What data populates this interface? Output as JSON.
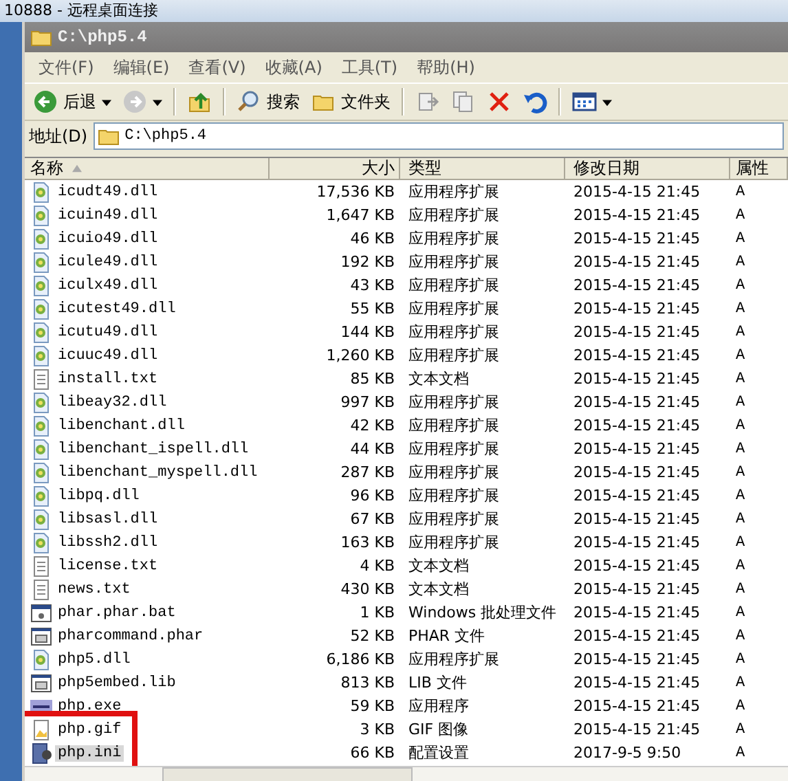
{
  "remote_title": "10888 - 远程桌面连接",
  "window": {
    "title": "C:\\php5.4"
  },
  "menu": [
    "文件(F)",
    "编辑(E)",
    "查看(V)",
    "收藏(A)",
    "工具(T)",
    "帮助(H)"
  ],
  "toolbar": [
    {
      "kind": "back",
      "label": "后退"
    },
    {
      "kind": "forward"
    },
    {
      "kind": "up"
    },
    {
      "kind": "search",
      "label": "搜索"
    },
    {
      "kind": "folders",
      "label": "文件夹"
    },
    {
      "kind": "move"
    },
    {
      "kind": "copy"
    },
    {
      "kind": "delete"
    },
    {
      "kind": "undo"
    },
    {
      "kind": "views"
    }
  ],
  "address": {
    "label": "地址(D)",
    "value": "C:\\php5.4"
  },
  "columns": [
    "名称",
    "大小",
    "类型",
    "修改日期",
    "属性"
  ],
  "rows": [
    {
      "kind": "dll",
      "name": "icudt49.dll",
      "size": "17,536 KB",
      "type": "应用程序扩展",
      "date": "2015-4-15 21:45",
      "attr": "A",
      "selected": false
    },
    {
      "kind": "dll",
      "name": "icuin49.dll",
      "size": "1,647 KB",
      "type": "应用程序扩展",
      "date": "2015-4-15 21:45",
      "attr": "A",
      "selected": false
    },
    {
      "kind": "dll",
      "name": "icuio49.dll",
      "size": "46 KB",
      "type": "应用程序扩展",
      "date": "2015-4-15 21:45",
      "attr": "A",
      "selected": false
    },
    {
      "kind": "dll",
      "name": "icule49.dll",
      "size": "192 KB",
      "type": "应用程序扩展",
      "date": "2015-4-15 21:45",
      "attr": "A",
      "selected": false
    },
    {
      "kind": "dll",
      "name": "iculx49.dll",
      "size": "43 KB",
      "type": "应用程序扩展",
      "date": "2015-4-15 21:45",
      "attr": "A",
      "selected": false
    },
    {
      "kind": "dll",
      "name": "icutest49.dll",
      "size": "55 KB",
      "type": "应用程序扩展",
      "date": "2015-4-15 21:45",
      "attr": "A",
      "selected": false
    },
    {
      "kind": "dll",
      "name": "icutu49.dll",
      "size": "144 KB",
      "type": "应用程序扩展",
      "date": "2015-4-15 21:45",
      "attr": "A",
      "selected": false
    },
    {
      "kind": "dll",
      "name": "icuuc49.dll",
      "size": "1,260 KB",
      "type": "应用程序扩展",
      "date": "2015-4-15 21:45",
      "attr": "A",
      "selected": false
    },
    {
      "kind": "txt",
      "name": "install.txt",
      "size": "85 KB",
      "type": "文本文档",
      "date": "2015-4-15 21:45",
      "attr": "A",
      "selected": false
    },
    {
      "kind": "dll",
      "name": "libeay32.dll",
      "size": "997 KB",
      "type": "应用程序扩展",
      "date": "2015-4-15 21:45",
      "attr": "A",
      "selected": false
    },
    {
      "kind": "dll",
      "name": "libenchant.dll",
      "size": "42 KB",
      "type": "应用程序扩展",
      "date": "2015-4-15 21:45",
      "attr": "A",
      "selected": false
    },
    {
      "kind": "dll",
      "name": "libenchant_ispell.dll",
      "size": "44 KB",
      "type": "应用程序扩展",
      "date": "2015-4-15 21:45",
      "attr": "A",
      "selected": false
    },
    {
      "kind": "dll",
      "name": "libenchant_myspell.dll",
      "size": "287 KB",
      "type": "应用程序扩展",
      "date": "2015-4-15 21:45",
      "attr": "A",
      "selected": false
    },
    {
      "kind": "dll",
      "name": "libpq.dll",
      "size": "96 KB",
      "type": "应用程序扩展",
      "date": "2015-4-15 21:45",
      "attr": "A",
      "selected": false
    },
    {
      "kind": "dll",
      "name": "libsasl.dll",
      "size": "67 KB",
      "type": "应用程序扩展",
      "date": "2015-4-15 21:45",
      "attr": "A",
      "selected": false
    },
    {
      "kind": "dll",
      "name": "libssh2.dll",
      "size": "163 KB",
      "type": "应用程序扩展",
      "date": "2015-4-15 21:45",
      "attr": "A",
      "selected": false
    },
    {
      "kind": "txt",
      "name": "license.txt",
      "size": "4 KB",
      "type": "文本文档",
      "date": "2015-4-15 21:45",
      "attr": "A",
      "selected": false
    },
    {
      "kind": "txt",
      "name": "news.txt",
      "size": "430 KB",
      "type": "文本文档",
      "date": "2015-4-15 21:45",
      "attr": "A",
      "selected": false
    },
    {
      "kind": "bat",
      "name": "phar.phar.bat",
      "size": "1 KB",
      "type": "Windows 批处理文件",
      "date": "2015-4-15 21:45",
      "attr": "A",
      "selected": false
    },
    {
      "kind": "app",
      "name": "pharcommand.phar",
      "size": "52 KB",
      "type": "PHAR 文件",
      "date": "2015-4-15 21:45",
      "attr": "A",
      "selected": false
    },
    {
      "kind": "dll",
      "name": "php5.dll",
      "size": "6,186 KB",
      "type": "应用程序扩展",
      "date": "2015-4-15 21:45",
      "attr": "A",
      "selected": false
    },
    {
      "kind": "app",
      "name": "php5embed.lib",
      "size": "813 KB",
      "type": "LIB 文件",
      "date": "2015-4-15 21:45",
      "attr": "A",
      "selected": false
    },
    {
      "kind": "exe",
      "name": "php.exe",
      "size": "59 KB",
      "type": "应用程序",
      "date": "2015-4-15 21:45",
      "attr": "A",
      "selected": false
    },
    {
      "kind": "gif",
      "name": "php.gif",
      "size": "3 KB",
      "type": "GIF 图像",
      "date": "2015-4-15 21:45",
      "attr": "A",
      "selected": false
    },
    {
      "kind": "ini",
      "name": "php.ini",
      "size": "66 KB",
      "type": "配置设置",
      "date": "2017-9-5 9:50",
      "attr": "A",
      "selected": true
    }
  ],
  "highlight_frame": true
}
